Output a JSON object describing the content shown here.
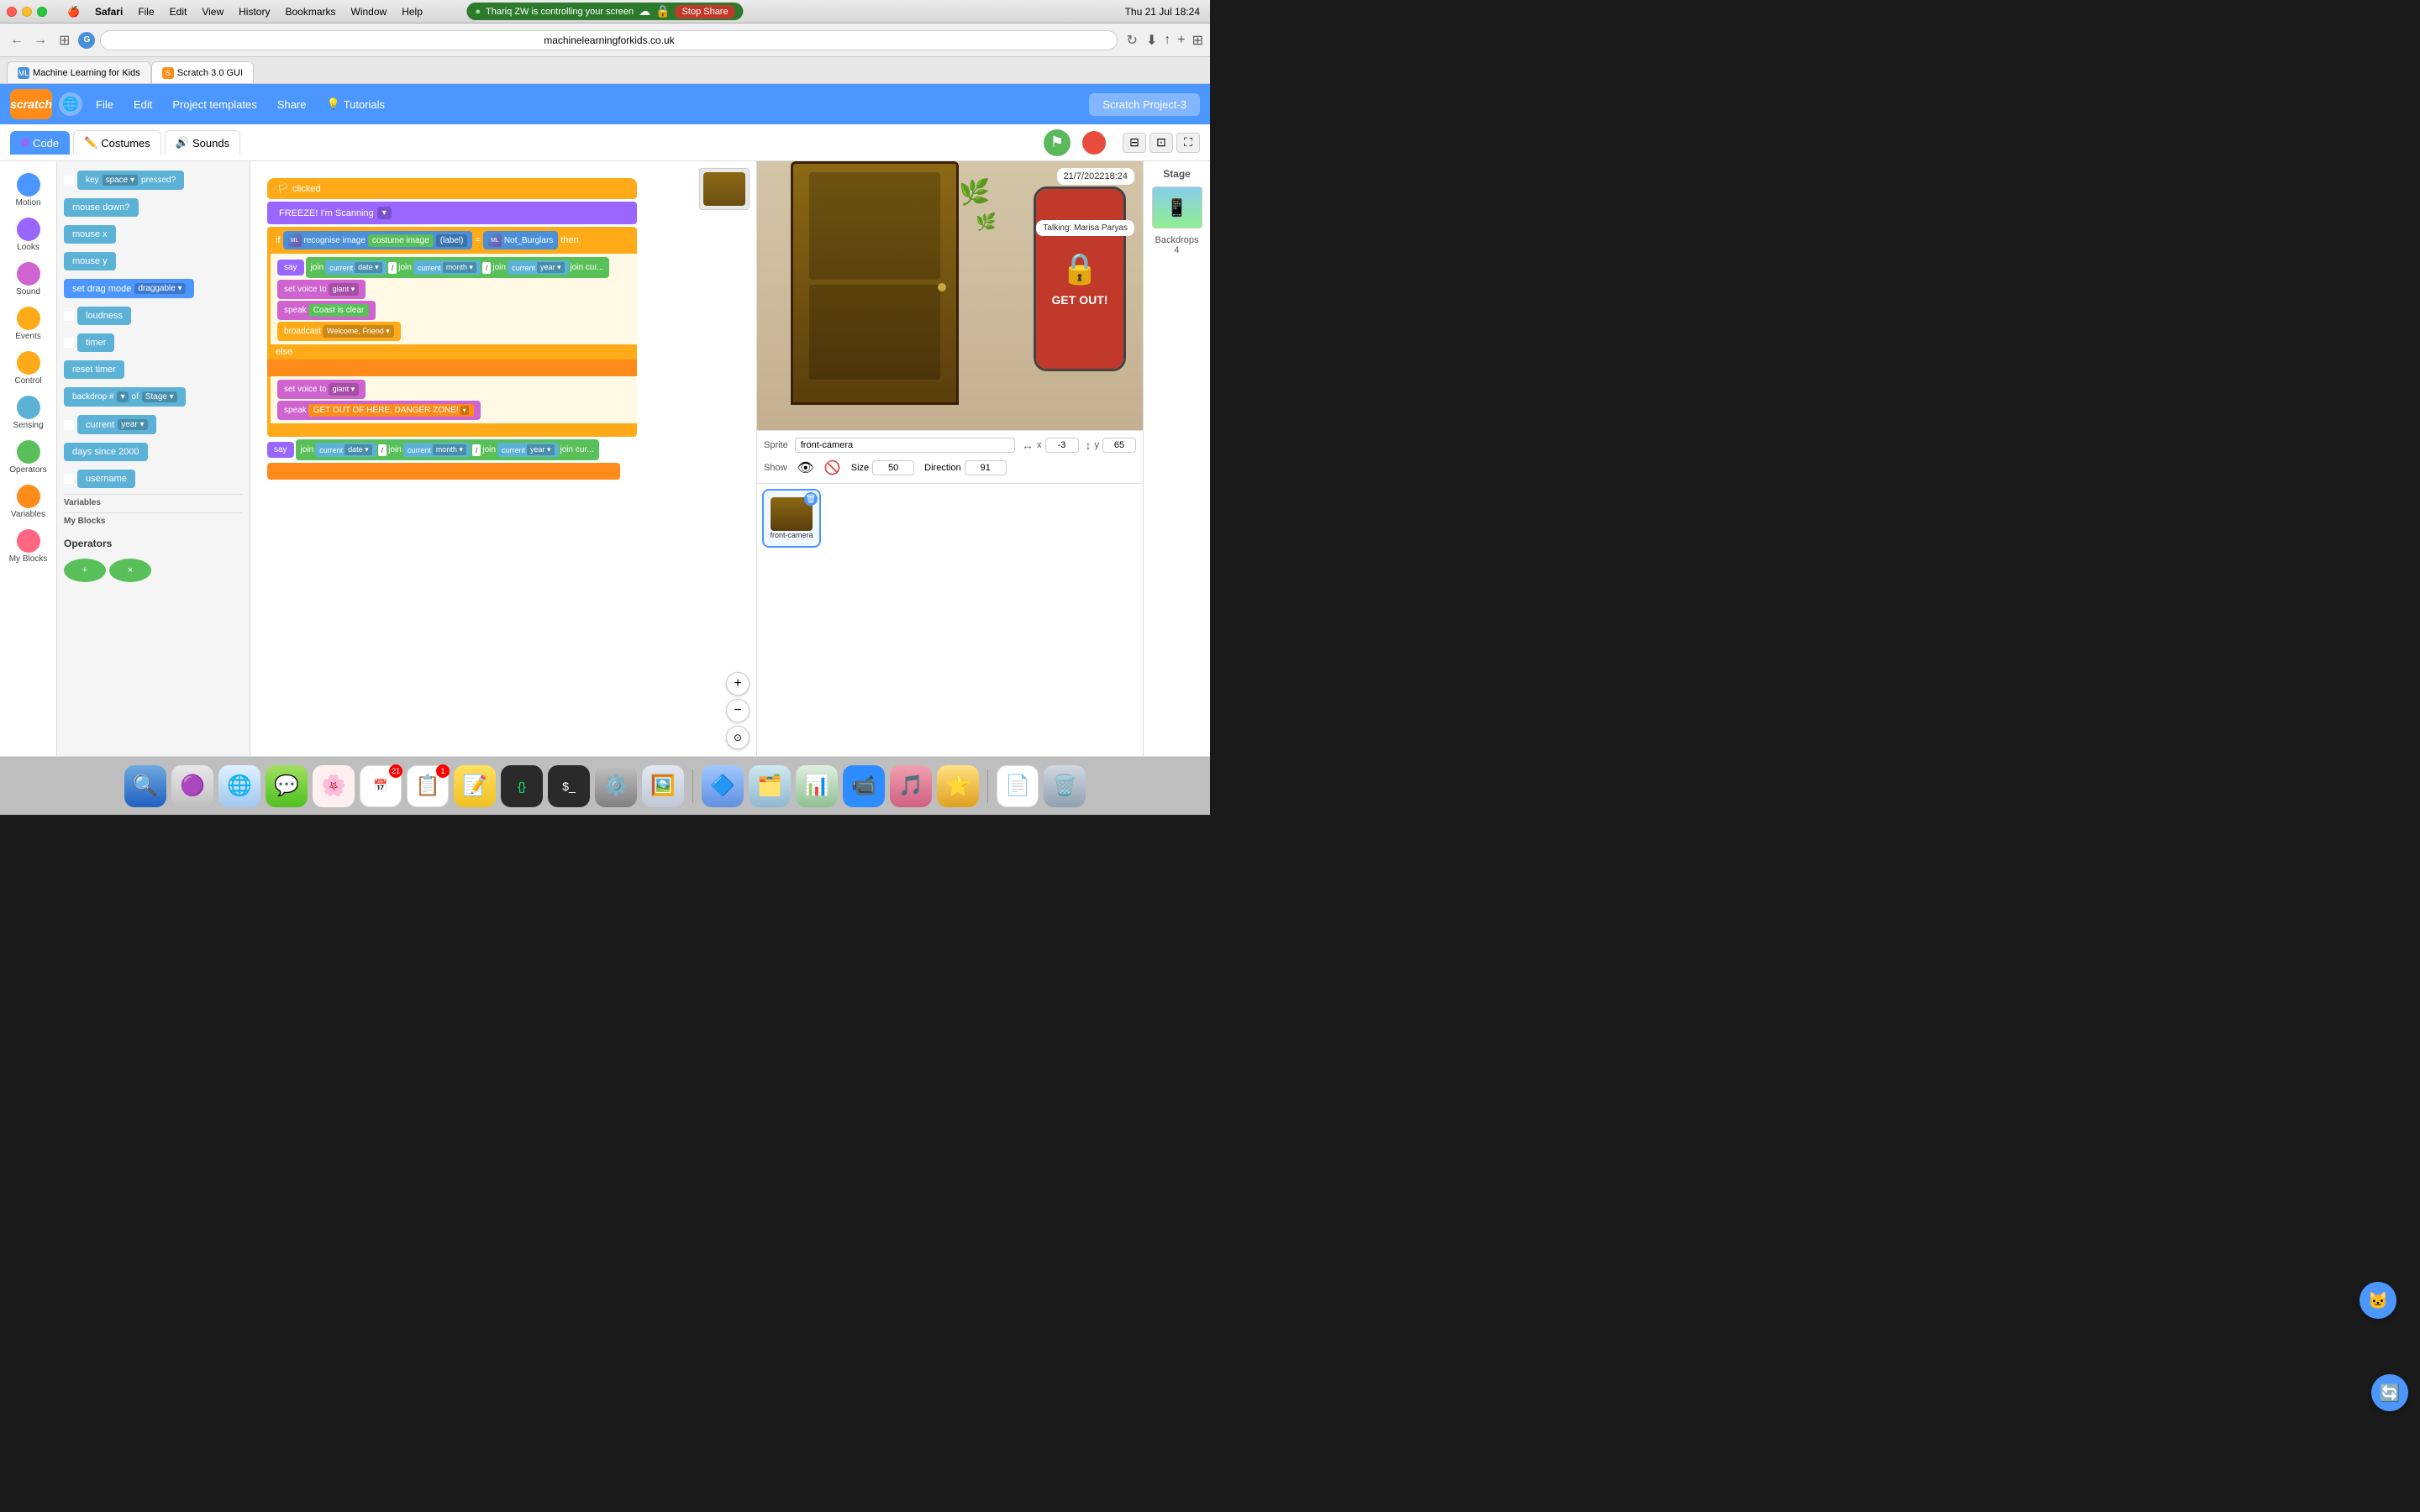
{
  "mac": {
    "titlebar": {
      "menu_items": [
        "Apple",
        "Safari",
        "File",
        "Edit",
        "View",
        "History",
        "Bookmarks",
        "Window",
        "Help"
      ],
      "time": "Thu 21 Jul  18:24",
      "screen_share_text": "Thariq ZW is controlling your screen",
      "stop_share_label": "Stop Share"
    },
    "browser": {
      "url": "machinelearningforkids.co.uk",
      "tabs": [
        {
          "label": "Machine Learning for Kids",
          "active": false
        },
        {
          "label": "Scratch 3.0 GUI",
          "active": true
        }
      ]
    }
  },
  "scratch": {
    "header": {
      "logo": "scratch",
      "globe_label": "",
      "nav_items": [
        "File",
        "Edit",
        "Project templates",
        "Share"
      ],
      "tutorials_label": "Tutorials",
      "project_name": "Scratch Project-3"
    },
    "toolbar": {
      "code_label": "Code",
      "costumes_label": "Costumes",
      "sounds_label": "Sounds"
    },
    "categories": [
      {
        "id": "looks",
        "label": "Looks",
        "color": "#9966ff"
      },
      {
        "id": "sound",
        "label": "Sound",
        "color": "#cf63cf"
      },
      {
        "id": "events",
        "label": "Events",
        "color": "#ffab19"
      },
      {
        "id": "control",
        "label": "Control",
        "color": "#ffab19"
      },
      {
        "id": "sensing",
        "label": "Sensing",
        "color": "#5cb1d6"
      },
      {
        "id": "operators",
        "label": "Operators",
        "color": "#59c059"
      },
      {
        "id": "variables",
        "label": "Variables",
        "color": "#ff8c1a"
      },
      {
        "id": "myblocks",
        "label": "My Blocks",
        "color": "#ff6680"
      }
    ],
    "blocks": {
      "motion_blocks": [
        {
          "text": "key space ▾ pressed?",
          "type": "sensing"
        },
        {
          "text": "mouse down?",
          "type": "sensing"
        },
        {
          "text": "mouse x",
          "type": "sensing"
        },
        {
          "text": "mouse y",
          "type": "sensing"
        },
        {
          "text": "set drag mode draggable ▾",
          "type": "motion"
        },
        {
          "text": "loudness",
          "type": "sensing"
        },
        {
          "text": "timer",
          "type": "sensing"
        },
        {
          "text": "reset timer",
          "type": "sensing"
        },
        {
          "text": "backdrop # ▾ of Stage ▾",
          "type": "sensing"
        },
        {
          "text": "current year ▾",
          "type": "sensing"
        },
        {
          "text": "days since 2000",
          "type": "sensing"
        },
        {
          "text": "username",
          "type": "sensing"
        }
      ],
      "section_variables": "Variables",
      "section_myblocks": "My Blocks",
      "operators_label": "Operators"
    },
    "canvas": {
      "when_clicked": "when 🏳 clicked",
      "freeze_block": "FREEZE! I'm Scanning",
      "recognise_label": "recognise image",
      "costume_image": "costume image",
      "label_text": "label",
      "equals": "=",
      "not_burglars": "Not_Burglars",
      "then": "then",
      "say_join": "say",
      "join": "join",
      "current": "current",
      "date": "date",
      "slash": "/",
      "month": "month",
      "year": "year",
      "set_voice": "set voice to",
      "giant": "giant",
      "speak": "speak",
      "coast_clear": "Coast is clear",
      "broadcast": "broadcast",
      "welcome_friend": "Welcome, Friend",
      "else_label": "else",
      "get_out": "GET OUT OF HERE, DANGER ZONE!",
      "say2": "say",
      "current_year": "current year",
      "month2": "month"
    },
    "sprite": {
      "label": "Sprite",
      "name": "front-camera",
      "x_label": "x",
      "x_value": "-3",
      "y_label": "y",
      "y_value": "65",
      "show_label": "Show",
      "size_label": "Size",
      "size_value": "50",
      "direction_label": "Direction",
      "direction_value": "91"
    },
    "stage": {
      "label": "Stage",
      "backdrops_label": "Backdrops",
      "backdrops_count": "4",
      "speech_bubble": "21/7/202218:24",
      "talking_label": "Talking: Marisa Paryas"
    }
  },
  "dock": {
    "items": [
      {
        "icon": "🔍",
        "label": "Finder"
      },
      {
        "icon": "🟣",
        "label": "Launchpad"
      },
      {
        "icon": "🌐",
        "label": "Safari"
      },
      {
        "icon": "💬",
        "label": "Messages"
      },
      {
        "icon": "🌸",
        "label": "Photos"
      },
      {
        "icon": "📅",
        "label": "Calendar",
        "badge": "21"
      },
      {
        "icon": "📋",
        "label": "Reminders",
        "badge": "1"
      },
      {
        "icon": "📝",
        "label": "Notes"
      },
      {
        "icon": "🔧",
        "label": "Script Editor"
      },
      {
        "icon": "💻",
        "label": "Terminal"
      },
      {
        "icon": "⚙️",
        "label": "System Preferences"
      },
      {
        "icon": "🖼️",
        "label": "Preview"
      },
      {
        "icon": "🔷",
        "label": "Plasticity"
      },
      {
        "icon": "📦",
        "label": "Finder2"
      },
      {
        "icon": "📊",
        "label": "Activity Monitor"
      },
      {
        "icon": "📹",
        "label": "Zoom"
      },
      {
        "icon": "🎵",
        "label": "Music"
      },
      {
        "icon": "⭐",
        "label": "Mango5Star"
      },
      {
        "icon": "📄",
        "label": "TextEdit"
      },
      {
        "icon": "🗑️",
        "label": "Trash"
      }
    ]
  }
}
